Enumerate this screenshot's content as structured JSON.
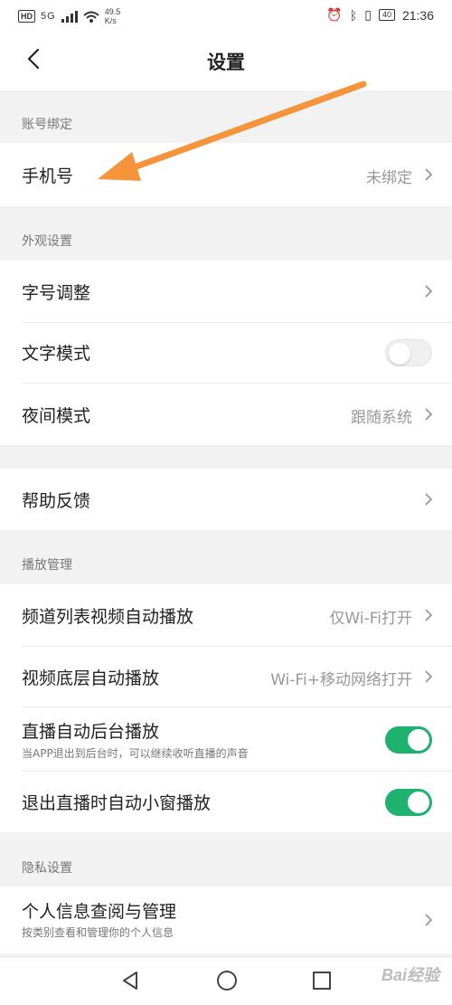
{
  "status_bar": {
    "hd": "HD",
    "network": "5G",
    "speed_value": "49.5",
    "speed_unit": "K/s",
    "battery": "40",
    "time": "21:36"
  },
  "nav": {
    "title": "设置"
  },
  "sections": {
    "account": "账号绑定",
    "appearance": "外观设置",
    "playback": "播放管理",
    "privacy": "隐私设置"
  },
  "rows": {
    "phone": {
      "label": "手机号",
      "value": "未绑定"
    },
    "font_size": {
      "label": "字号调整"
    },
    "text_mode": {
      "label": "文字模式",
      "enabled": false
    },
    "night_mode": {
      "label": "夜间模式",
      "value": "跟随系统"
    },
    "help": {
      "label": "帮助反馈"
    },
    "channel_autoplay": {
      "label": "频道列表视频自动播放",
      "value": "仅Wi-Fi打开"
    },
    "video_autoplay": {
      "label": "视频底层自动播放",
      "value": "Wi-Fi+移动网络打开"
    },
    "live_background": {
      "label": "直播自动后台播放",
      "sub": "当APP退出到后台时，可以继续收听直播的声音",
      "enabled": true
    },
    "live_mini": {
      "label": "退出直播时自动小窗播放",
      "enabled": true
    },
    "personal_info": {
      "label": "个人信息查阅与管理",
      "sub": "按类别查看和管理你的个人信息"
    }
  },
  "watermark": "Bai经验",
  "colors": {
    "toggle_on": "#1db36f",
    "annotation_arrow": "#f5943a",
    "background": "#f2f2f2"
  }
}
